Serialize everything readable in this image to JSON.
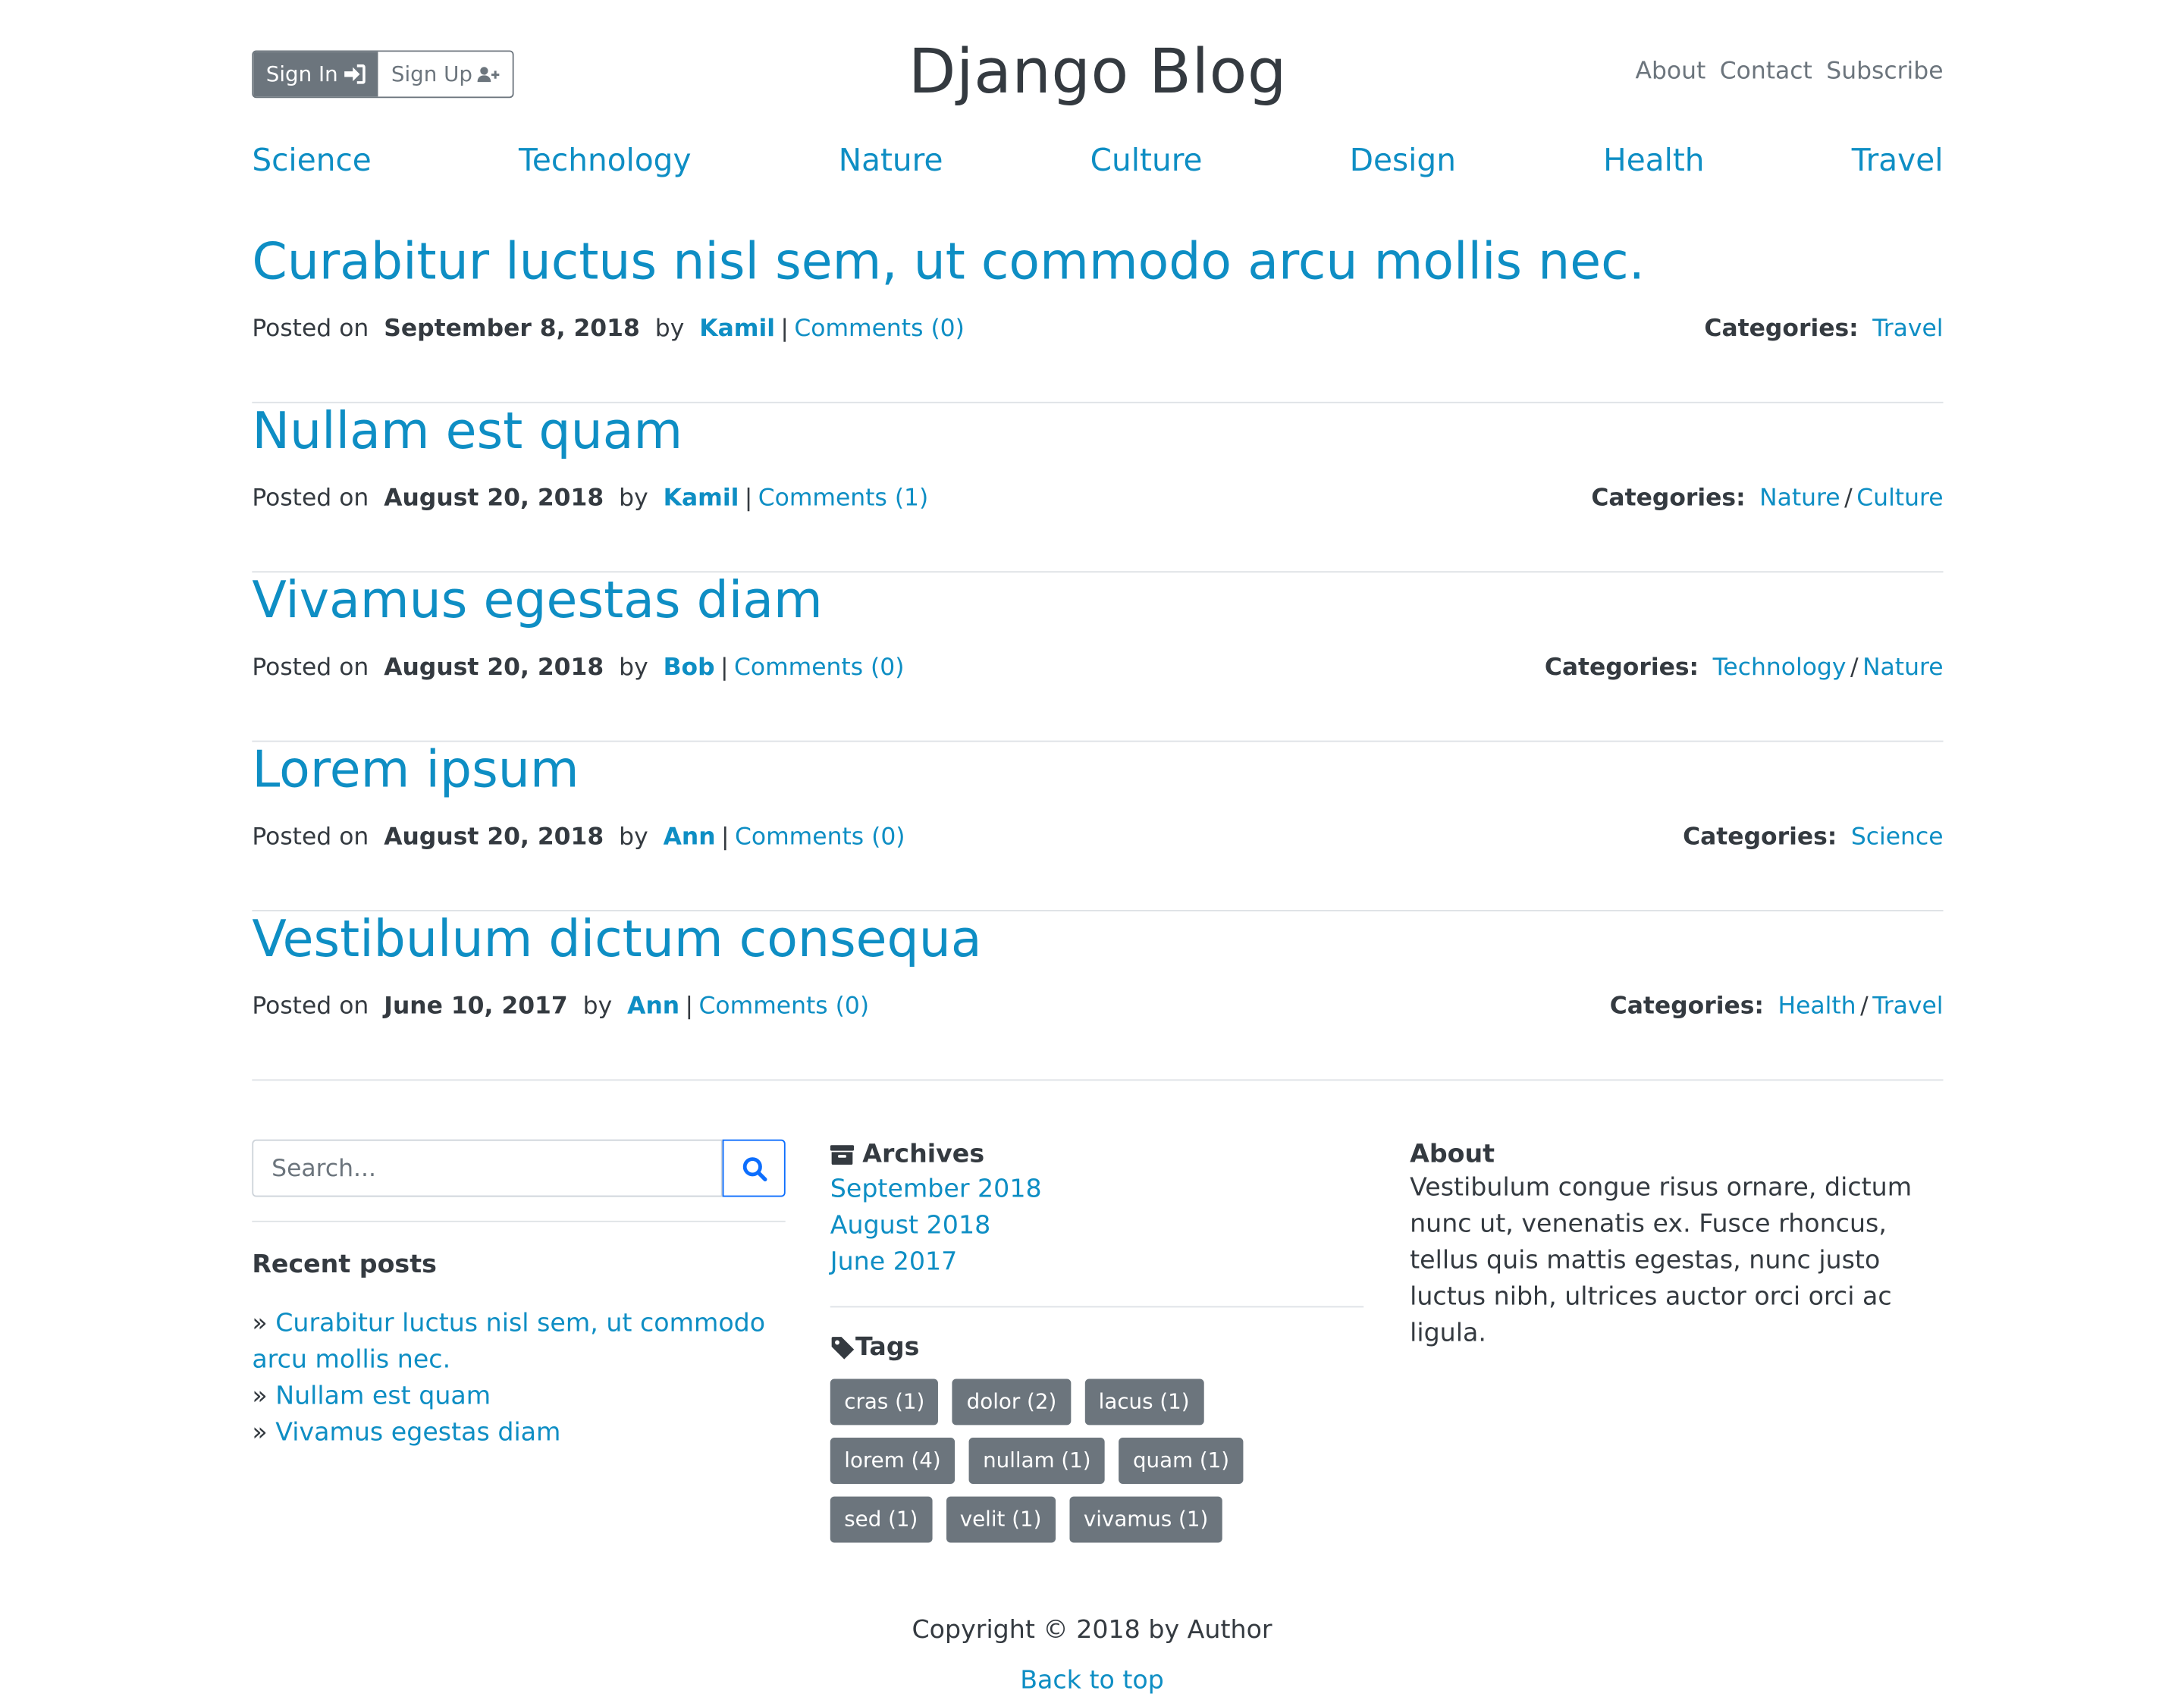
{
  "header": {
    "signin_label": "Sign In",
    "signup_label": "Sign Up",
    "site_title": "Django Blog",
    "links": [
      "About",
      "Contact",
      "Subscribe"
    ]
  },
  "categories_nav": [
    "Science",
    "Technology",
    "Nature",
    "Culture",
    "Design",
    "Health",
    "Travel"
  ],
  "posts": [
    {
      "title": "Curabitur luctus nisl sem, ut commodo arcu mollis nec.",
      "posted_label": "Posted on",
      "date": "September 8, 2018",
      "by_label": "by",
      "author": "Kamil",
      "comments": "Comments (0)",
      "categories_label": "Categories:",
      "categories": [
        "Travel"
      ]
    },
    {
      "title": "Nullam est quam",
      "posted_label": "Posted on",
      "date": "August 20, 2018",
      "by_label": "by",
      "author": "Kamil",
      "comments": "Comments (1)",
      "categories_label": "Categories:",
      "categories": [
        "Nature",
        "Culture"
      ]
    },
    {
      "title": "Vivamus egestas diam",
      "posted_label": "Posted on",
      "date": "August 20, 2018",
      "by_label": "by",
      "author": "Bob",
      "comments": "Comments (0)",
      "categories_label": "Categories:",
      "categories": [
        "Technology",
        "Nature"
      ]
    },
    {
      "title": "Lorem ipsum",
      "posted_label": "Posted on",
      "date": "August 20, 2018",
      "by_label": "by",
      "author": "Ann",
      "comments": "Comments (0)",
      "categories_label": "Categories:",
      "categories": [
        "Science"
      ]
    },
    {
      "title": "Vestibulum dictum consequa",
      "posted_label": "Posted on",
      "date": "June 10, 2017",
      "by_label": "by",
      "author": "Ann",
      "comments": "Comments (0)",
      "categories_label": "Categories:",
      "categories": [
        "Health",
        "Travel"
      ]
    }
  ],
  "sidebar": {
    "search_placeholder": "Search...",
    "recent_title": "Recent posts",
    "recent_posts": [
      "Curabitur luctus nisl sem, ut commodo arcu mollis nec.",
      "Nullam est quam",
      "Vivamus egestas diam"
    ],
    "archives_title": "Archives",
    "archives": [
      "September 2018",
      "August 2018",
      "June 2017"
    ],
    "tags_title": "Tags",
    "tags": [
      "cras (1)",
      "dolor (2)",
      "lacus (1)",
      "lorem (4)",
      "nullam (1)",
      "quam (1)",
      "sed (1)",
      "velit (1)",
      "vivamus (1)"
    ],
    "about_title": "About",
    "about_text": "Vestibulum congue risus ornare, dictum nunc ut, venenatis ex. Fusce rhoncus, tellus quis mattis egestas, nunc justo luctus nibh, ultrices auctor orci orci ac ligula."
  },
  "footer": {
    "copyright": "Copyright © 2018 by Author",
    "back_to_top": "Back to top"
  },
  "colors": {
    "link": "#0e8ec4",
    "tag_bg": "#6c757d",
    "text": "#343a40",
    "search_accent": "#0d6efd"
  }
}
